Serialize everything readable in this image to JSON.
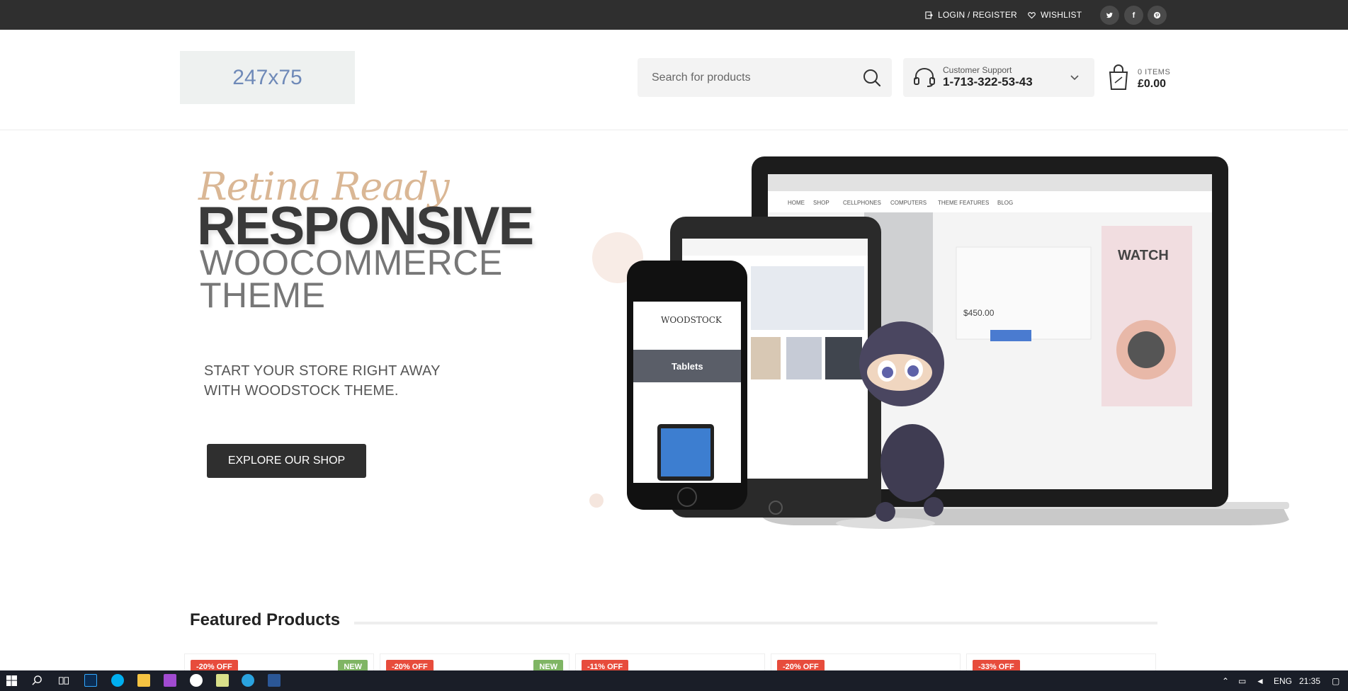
{
  "topbar": {
    "login_label": "LOGIN / REGISTER",
    "wishlist_label": "WISHLIST",
    "social": [
      "twitter-icon",
      "facebook-icon",
      "pinterest-icon"
    ]
  },
  "header": {
    "logo_text": "247x75",
    "search_placeholder": "Search for products",
    "support_label": "Customer Support",
    "support_phone": "1-713-322-53-43",
    "cart_items": "0 ITEMS",
    "cart_total": "£0.00"
  },
  "hero": {
    "retina": "Retina Ready",
    "responsive": "RESPONSIVE",
    "woo_line1": "WOOCOMMERCE",
    "woo_line2": "THEME",
    "tagline_line1": "START YOUR STORE RIGHT AWAY",
    "tagline_line2": "WITH WOODSTOCK THEME.",
    "button_label": "EXPLORE OUR SHOP",
    "mock": {
      "phone_brand": "WOODSTOCK",
      "phone_section": "Tablets",
      "laptop_nav": [
        "HOME",
        "SHOP",
        "CELLPHONES",
        "COMPUTERS",
        "THEME FEATURES",
        "BLOG"
      ],
      "laptop_price": "$450.00",
      "laptop_watch": "WATCH"
    }
  },
  "featured": {
    "title": "Featured Products",
    "cards": [
      {
        "discount": "-20% OFF",
        "new": "NEW"
      },
      {
        "discount": "-20% OFF",
        "new": "NEW"
      },
      {
        "discount": "-11% OFF",
        "new": ""
      },
      {
        "discount": "-20% OFF",
        "new": ""
      },
      {
        "discount": "-33% OFF",
        "new": ""
      }
    ]
  },
  "taskbar": {
    "lang": "ENG",
    "time": "21:35"
  },
  "colors": {
    "topbar_bg": "#2f2f2f",
    "accent_badge": "#e74c3c",
    "new_badge": "#7fb564"
  }
}
